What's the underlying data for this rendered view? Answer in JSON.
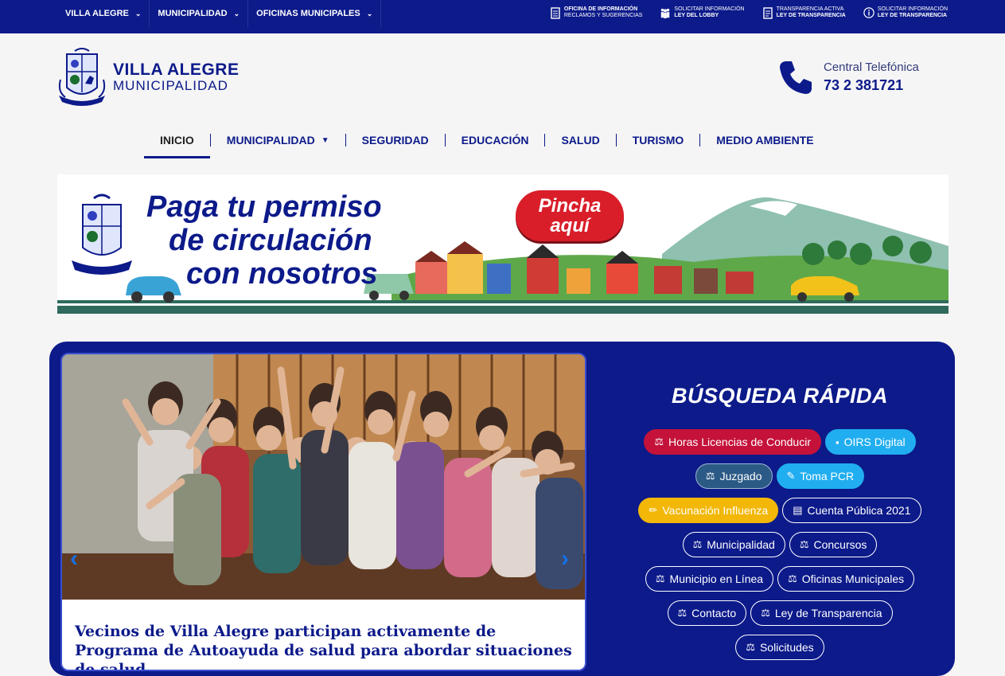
{
  "topnav": [
    {
      "label": "VILLA ALEGRE"
    },
    {
      "label": "MUNICIPALIDAD"
    },
    {
      "label": "OFICINAS MUNICIPALES"
    }
  ],
  "toplinks": [
    {
      "line1": "OFICINA DE INFORMACIÓN",
      "line2": "RECLAMOS Y SUGERENCIAS",
      "icon": "document-icon"
    },
    {
      "line1": "SOLICITAR INFORMACIÓN",
      "line2": "LEY DEL LOBBY",
      "icon": "people-icon"
    },
    {
      "line1": "TRANSPARENCIA ACTIVA",
      "line2": "LEY DE TRANSPARENCIA",
      "icon": "list-document-icon"
    },
    {
      "line1": "SOLICITAR INFORMACIÓN",
      "line2": "LEY DE TRANSPARENCIA",
      "icon": "info-icon"
    }
  ],
  "logo": {
    "line1": "VILLA ALEGRE",
    "line2": "MUNICIPALIDAD"
  },
  "phone": {
    "label": "Central Telefónica",
    "number": "73 2 381721"
  },
  "mainnav": [
    {
      "label": "INICIO",
      "active": true
    },
    {
      "label": "MUNICIPALIDAD",
      "dropdown": true
    },
    {
      "label": "SEGURIDAD"
    },
    {
      "label": "EDUCACIÓN"
    },
    {
      "label": "SALUD"
    },
    {
      "label": "TURISMO"
    },
    {
      "label": "MEDIO AMBIENTE"
    }
  ],
  "banner": {
    "title_line1": "Paga tu permiso",
    "title_line2": "de circulación",
    "title_line3": "con nosotros",
    "button_line1": "Pincha",
    "button_line2": "aquí"
  },
  "slider": {
    "news_title": "Vecinos de Villa Alegre participan activamente de Programa de Autoayuda de salud para abordar situaciones de salud"
  },
  "quick_search": {
    "title": "BÚSQUEDA RÁPIDA",
    "rows": [
      [
        {
          "label": "Horas Licencias de Conducir",
          "style": "red",
          "icon": "scale-icon"
        },
        {
          "label": "OIRS Digital",
          "style": "cyan",
          "icon": "briefcase-icon"
        }
      ],
      [
        {
          "label": "Juzgado",
          "style": "slate",
          "icon": "scale-icon"
        },
        {
          "label": "Toma PCR",
          "style": "cyan",
          "icon": "syringe-icon"
        }
      ],
      [
        {
          "label": "Vacunación Influenza",
          "style": "yellow",
          "icon": "pencil-icon"
        },
        {
          "label": "Cuenta Pública 2021",
          "style": "outline",
          "icon": "newspaper-icon"
        }
      ],
      [
        {
          "label": "Municipalidad",
          "style": "outline",
          "icon": "scale-icon"
        },
        {
          "label": "Concursos",
          "style": "outline",
          "icon": "scale-icon"
        }
      ],
      [
        {
          "label": "Municipio en Línea",
          "style": "outline",
          "icon": "scale-icon"
        },
        {
          "label": "Oficinas Municipales",
          "style": "outline",
          "icon": "scale-icon"
        }
      ],
      [
        {
          "label": "Contacto",
          "style": "outline",
          "icon": "scale-icon"
        },
        {
          "label": "Ley de Transparencia",
          "style": "outline",
          "icon": "scale-icon"
        }
      ],
      [
        {
          "label": "Solicitudes",
          "style": "outline",
          "icon": "scale-icon"
        }
      ]
    ]
  },
  "colors": {
    "brand": "#0c1a8a",
    "red": "#c4123a",
    "cyan": "#21aef0",
    "yellow": "#f2b707"
  }
}
